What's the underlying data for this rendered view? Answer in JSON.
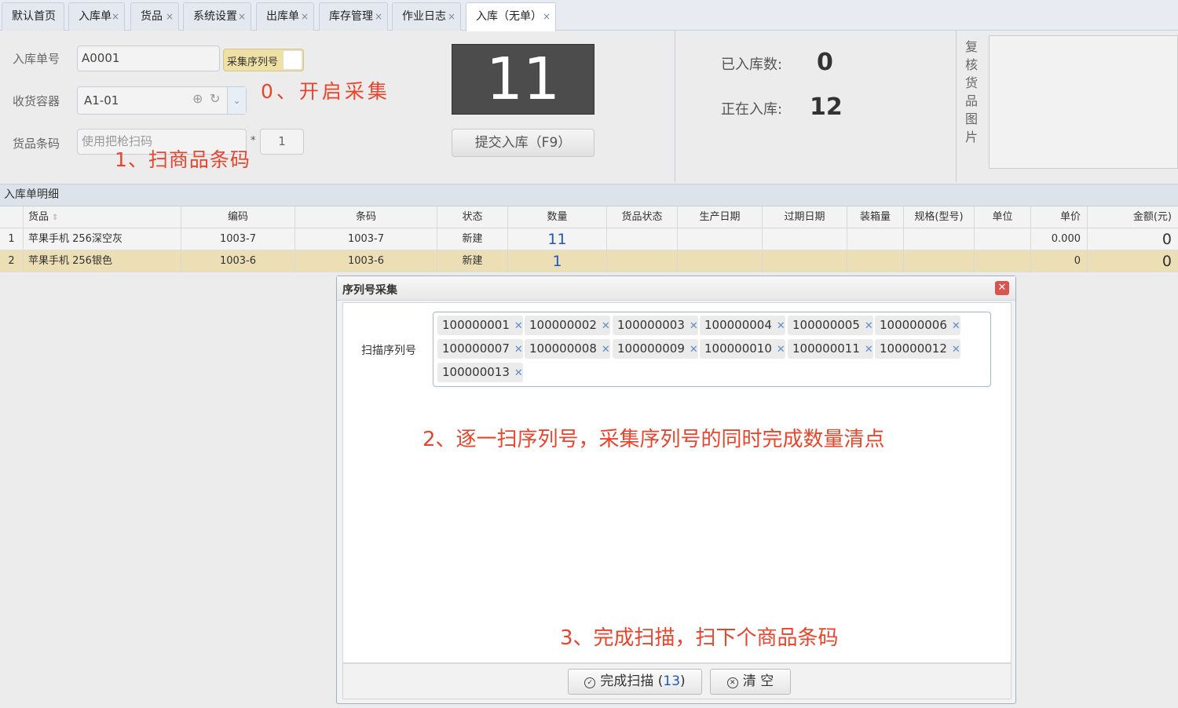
{
  "tabs": [
    {
      "label": "默认首页",
      "closable": false
    },
    {
      "label": "入库单",
      "closable": true
    },
    {
      "label": "货品",
      "closable": true
    },
    {
      "label": "系统设置",
      "closable": true
    },
    {
      "label": "出库单",
      "closable": true
    },
    {
      "label": "库存管理",
      "closable": true
    },
    {
      "label": "作业日志",
      "closable": true
    },
    {
      "label": "入库（无单）",
      "closable": true,
      "active": true
    }
  ],
  "tab_close_glyph": "×",
  "form": {
    "order_no_label": "入库单号",
    "order_no_value": "A0001",
    "serial_toggle_label": "采集序列号",
    "container_label": "收货容器",
    "container_value": "A1-01",
    "barcode_label": "货品条码",
    "barcode_placeholder": "使用把枪扫码",
    "multiply_sign": "*",
    "quantity_value": "1"
  },
  "annotations": {
    "step0": "0、开启采集",
    "step1": "1、扫商品条码",
    "step2": "2、逐一扫序列号，采集序列号的同时完成数量清点",
    "step3": "3、完成扫描，扫下个商品条码"
  },
  "counter_display": "11",
  "submit_button": "提交入库（F9）",
  "stats": {
    "stored_label": "已入库数:",
    "stored_value": "0",
    "storing_label": "正在入库:",
    "storing_value": "12"
  },
  "image_panel_label": "复核货品图片",
  "detail": {
    "title": "入库单明细",
    "columns": [
      "货品",
      "编码",
      "条码",
      "状态",
      "数量",
      "货品状态",
      "生产日期",
      "过期日期",
      "装箱量",
      "规格(型号)",
      "单位",
      "单价",
      "金额(元)"
    ],
    "rows": [
      {
        "no": "1",
        "goods": "苹果手机 256深空灰",
        "code": "1003-7",
        "barcode": "1003-7",
        "status": "新建",
        "qty": "11",
        "unit_price": "0.000",
        "amount": "0"
      },
      {
        "no": "2",
        "goods": "苹果手机 256银色",
        "code": "1003-6",
        "barcode": "1003-6",
        "status": "新建",
        "qty": "1",
        "unit_price": "0",
        "amount": "0"
      }
    ]
  },
  "dialog": {
    "title": "序列号采集",
    "scan_label": "扫描序列号",
    "serials": [
      "100000001",
      "100000002",
      "100000003",
      "100000004",
      "100000005",
      "100000006",
      "100000007",
      "100000008",
      "100000009",
      "100000010",
      "100000011",
      "100000012",
      "100000013"
    ],
    "finish_label": "完成扫描 (",
    "finish_count": "13",
    "finish_suffix": ")",
    "clear_label": "清 空"
  },
  "colors": {
    "annotation": "#e8452c",
    "highlight_row": "#ecdfb6",
    "toggle_bg": "#efe1a6",
    "quantity_link": "#2055c8",
    "dialog_close": "#d9534f"
  }
}
